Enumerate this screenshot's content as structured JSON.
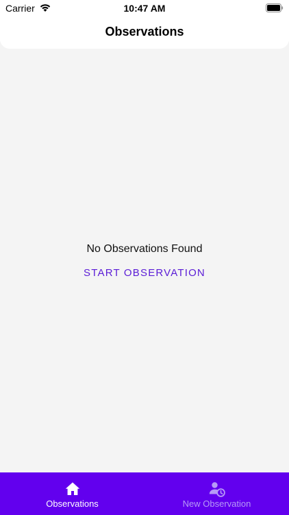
{
  "status_bar": {
    "carrier": "Carrier",
    "time": "10:47 AM",
    "icons": [
      "wifi-icon",
      "battery-icon"
    ]
  },
  "header": {
    "title": "Observations"
  },
  "main": {
    "empty_message": "No Observations Found",
    "start_button_label": "START OBSERVATION"
  },
  "tab_bar": {
    "tabs": [
      {
        "label": "Observations",
        "icon": "home-icon",
        "active": true
      },
      {
        "label": "New Observation",
        "icon": "person-clock-icon",
        "active": false
      }
    ]
  },
  "colors": {
    "accent": "#6200ee",
    "button_text": "#5a1bd6",
    "content_background": "#f4f4f4",
    "inactive_tab_text": "#b79af7"
  }
}
